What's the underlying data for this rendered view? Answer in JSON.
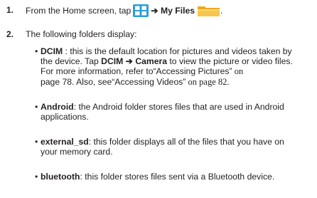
{
  "steps": [
    {
      "number": "1.",
      "prefix": "From the Home screen, tap",
      "arrow": "➔",
      "target": "My Files",
      "suffix": ".",
      "icons": [
        "apps-grid-icon",
        "my-files-folder-icon"
      ]
    },
    {
      "number": "2.",
      "text": "The following folders display:"
    }
  ],
  "folders": [
    {
      "name": "DCIM",
      "lines": [
        [
          " : this is the default location for pictures and videos taken by"
        ],
        [
          "the device. Tap "
        ],
        [
          "For more information, refer to"
        ],
        [
          "page 78. Also, see"
        ]
      ],
      "tap_path": [
        "DCIM",
        "➔",
        "Camera"
      ],
      "tap_suffix": " to view the picture or video files.",
      "ref1_title": "“Accessing Pictures”",
      "ref1_on": " on",
      "ref2_title": "“Accessing Videos”",
      "ref2_page": " on page 82."
    },
    {
      "name": "Android",
      "line1": ": the Android folder stores files that are used in Android",
      "line2": "applications."
    },
    {
      "name": "external_sd",
      "line1": ": this folder displays all of the files that you have on",
      "line2": "your memory card."
    },
    {
      "name": "bluetooth",
      "line1": ": this folder stores files sent via a Bluetooth device."
    }
  ],
  "colors": {
    "text": "#231f20",
    "apps_icon": "#2e9fd8",
    "folder_icon": "#f6b93b"
  }
}
